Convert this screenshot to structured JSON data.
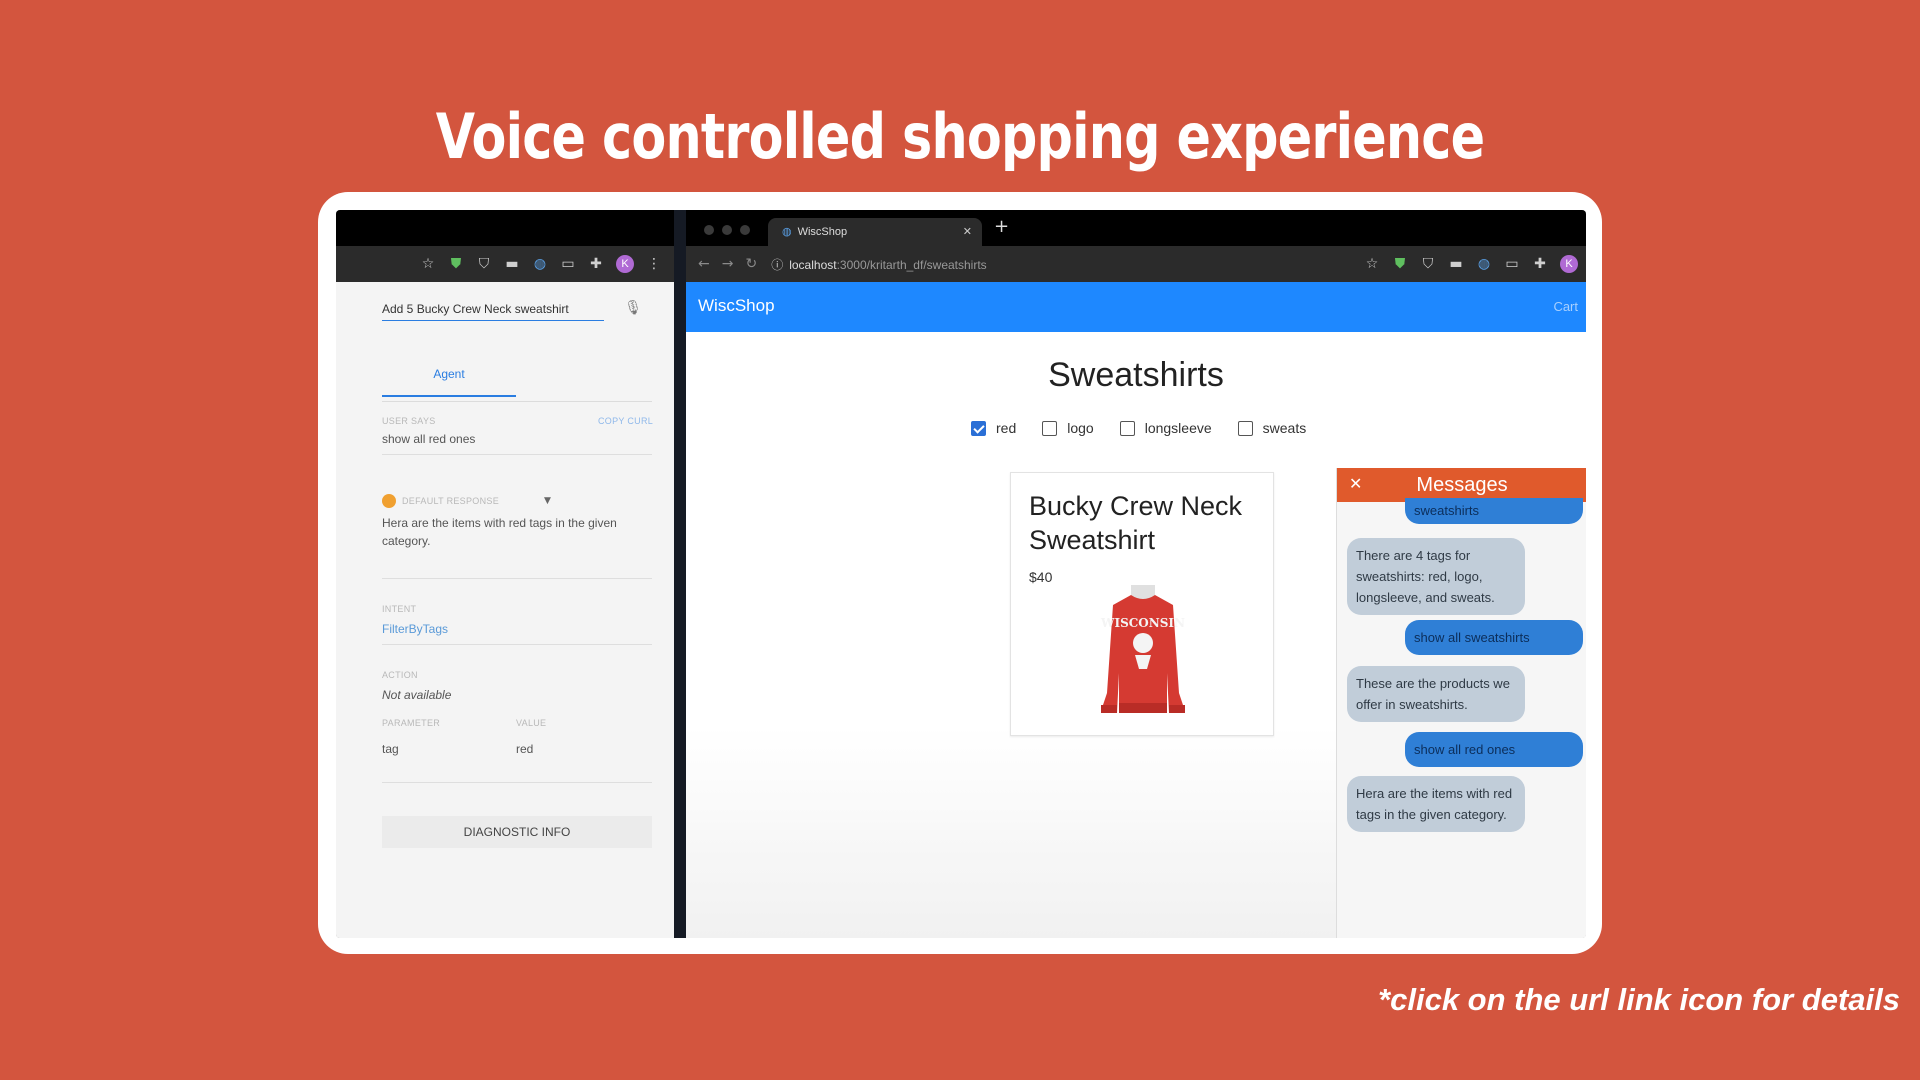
{
  "headline": "Voice controlled shopping experience",
  "footnote": "*click on the url link icon for details",
  "left_panel": {
    "query": "Add 5 Bucky Crew Neck sweatshirt",
    "tab_agent": "Agent",
    "user_says_label": "USER SAYS",
    "copy_curl": "COPY CURL",
    "user_says": "show all red ones",
    "default_response_label": "DEFAULT RESPONSE",
    "default_response": "Hera are the items with red tags in the given category.",
    "intent_label": "INTENT",
    "intent": "FilterByTags",
    "action_label": "ACTION",
    "action": "Not available",
    "parameter_label": "PARAMETER",
    "value_label": "VALUE",
    "parameter": "tag",
    "value": "red",
    "diagnostic_button": "DIAGNOSTIC INFO"
  },
  "browser": {
    "tab_title": "WiscShop",
    "url_host": "localhost",
    "url_path": ":3000/kritarth_df/sweatshirts"
  },
  "shop": {
    "brand": "WiscShop",
    "cart": "Cart",
    "page_title": "Sweatshirts",
    "filters": [
      {
        "label": "red",
        "checked": true
      },
      {
        "label": "logo",
        "checked": false
      },
      {
        "label": "longsleeve",
        "checked": false
      },
      {
        "label": "sweats",
        "checked": false
      }
    ],
    "product": {
      "title": "Bucky Crew Neck Sweatshirt",
      "price": "$40",
      "graphic_text": "WISCONSIN"
    }
  },
  "messages": {
    "title": "Messages",
    "items": [
      {
        "from": "user",
        "text": "sweatshirts"
      },
      {
        "from": "bot",
        "text": "There are 4 tags for sweatshirts: red, logo, longsleeve, and sweats."
      },
      {
        "from": "user",
        "text": "show all sweatshirts"
      },
      {
        "from": "bot",
        "text": "These are the products we offer in sweatshirts."
      },
      {
        "from": "user",
        "text": "show all red ones"
      },
      {
        "from": "bot",
        "text": "Hera are the items with red tags in the given category."
      }
    ]
  },
  "colors": {
    "background": "#d3553e",
    "app_bar": "#1e88ff",
    "messages_header": "#e05a2c",
    "user_bubble": "#2f7fd6",
    "bot_bubble": "#c1cdd9"
  }
}
